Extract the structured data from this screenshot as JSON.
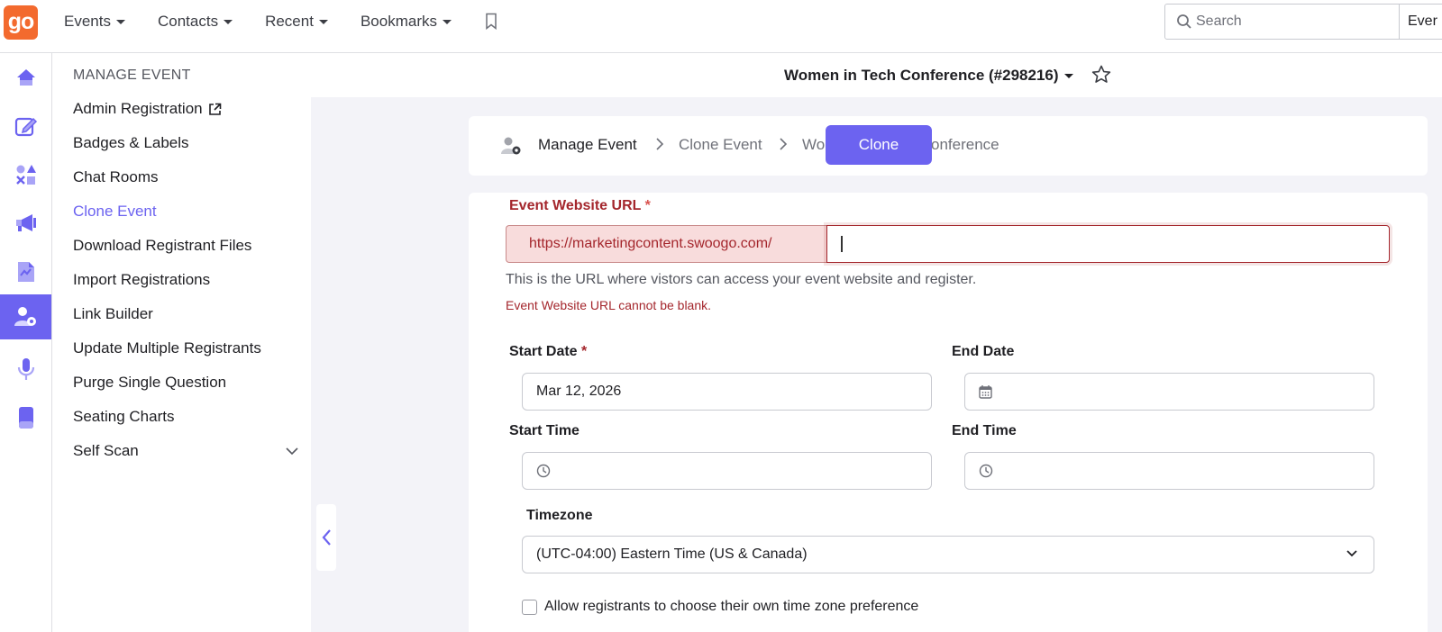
{
  "topbar": {
    "logo_text": "go",
    "nav": [
      {
        "label": "Events"
      },
      {
        "label": "Contacts"
      },
      {
        "label": "Recent"
      },
      {
        "label": "Bookmarks"
      }
    ],
    "search_placeholder": "Search",
    "search_scope": "Ever"
  },
  "rail": {
    "icons": [
      "home-icon",
      "edit-icon",
      "shapes-icon",
      "megaphone-icon",
      "report-icon",
      "manage-event-icon",
      "microphone-icon",
      "device-icon"
    ],
    "active": "manage-event-icon",
    "accent": "#6c63f0"
  },
  "menu": {
    "title": "MANAGE EVENT",
    "items": [
      {
        "label": "Admin Registration"
      },
      {
        "label": "Badges & Labels"
      },
      {
        "label": "Chat Rooms"
      },
      {
        "label": "Clone Event"
      },
      {
        "label": "Download Registrant Files"
      },
      {
        "label": "Import Registrations"
      },
      {
        "label": "Link Builder"
      },
      {
        "label": "Update Multiple Registrants"
      },
      {
        "label": "Purge Single Question"
      },
      {
        "label": "Seating Charts"
      },
      {
        "label": "Self Scan"
      }
    ],
    "active_item": "Clone Event"
  },
  "event": {
    "title": "Women in Tech Conference (#298216)"
  },
  "breadcrumb": {
    "items": [
      "Manage Event",
      "Clone Event",
      "Wo",
      "onference"
    ],
    "clone_button": "Clone"
  },
  "form": {
    "url_label": "Event Website URL",
    "url_required_mark": "*",
    "url_prefix": "https://marketingcontent.swoogo.com/",
    "url_value": "",
    "url_help": "This is the URL where vistors can access your event website and register.",
    "url_error": "Event Website URL cannot be blank.",
    "start_date_label": "Start Date",
    "start_date_required_mark": "*",
    "start_date_value": "Mar 12, 2026",
    "end_date_label": "End Date",
    "end_date_value": "",
    "start_time_label": "Start Time",
    "start_time_value": "",
    "end_time_label": "End Time",
    "end_time_value": "",
    "timezone_label": "Timezone",
    "timezone_value": "(UTC-04:00) Eastern Time (US & Canada)",
    "allow_tz_label": "Allow registrants to choose their own time zone preference",
    "allow_tz_checked": false
  }
}
